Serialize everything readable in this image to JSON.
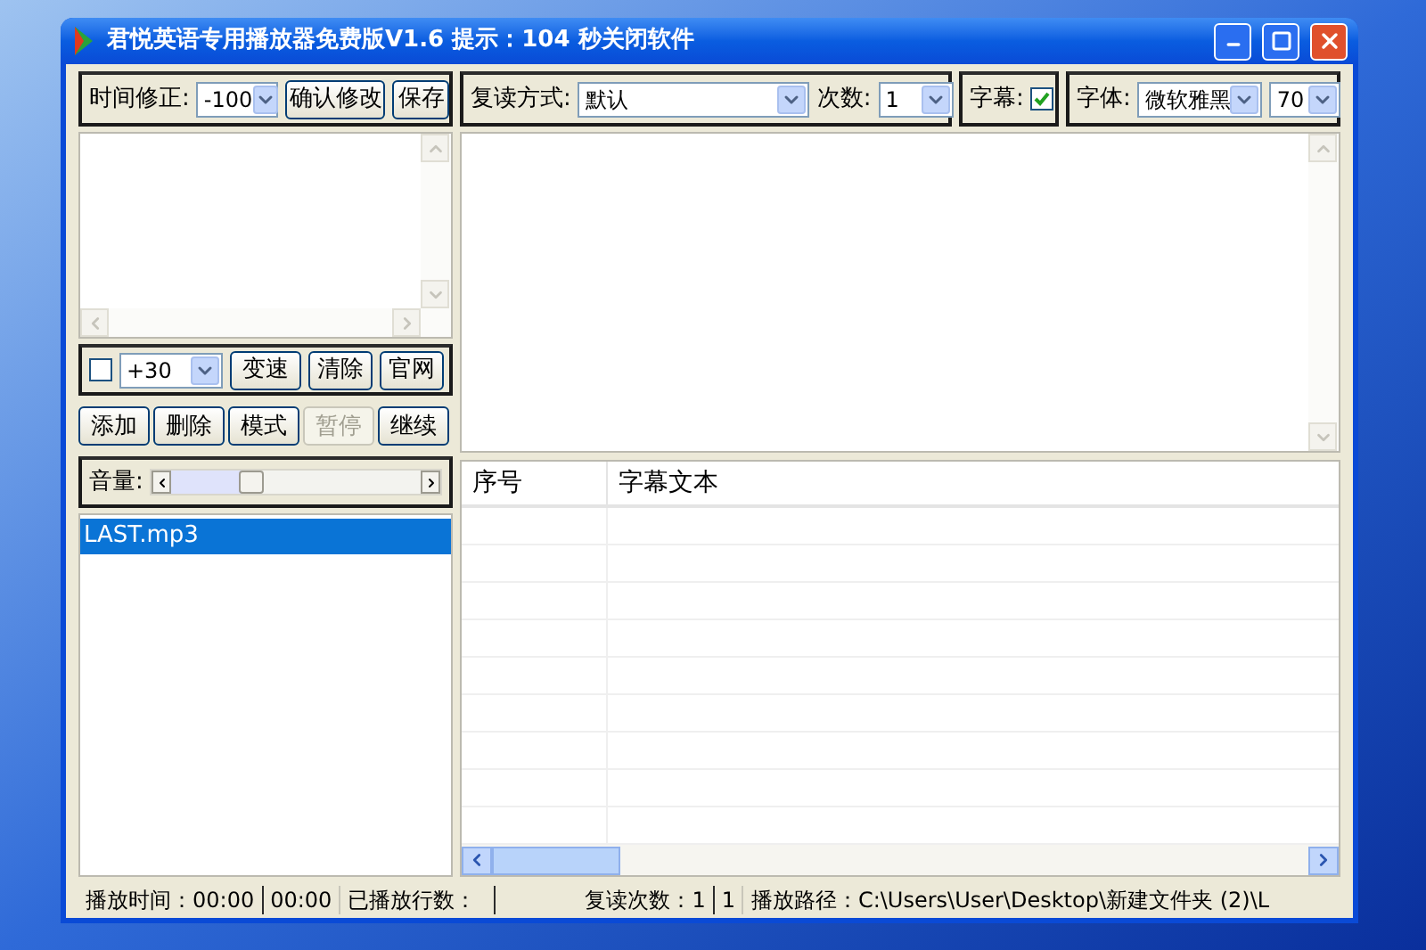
{
  "window": {
    "title": "君悦英语专用播放器免费版V1.6 提示：104 秒关闭软件"
  },
  "time_correction": {
    "label": "时间修正:",
    "value": "-100",
    "buttons": [
      "确认修改",
      "保存"
    ]
  },
  "repeat": {
    "label": "复读方式:",
    "value": "默认",
    "count_label": "次数:",
    "count_value": "1"
  },
  "subtitle": {
    "label": "字幕:",
    "checked": true
  },
  "font": {
    "label": "字体:",
    "value": "微软雅黑",
    "size": "70"
  },
  "speed": {
    "checked": false,
    "value": "+30",
    "buttons": [
      "变速",
      "清除",
      "官网"
    ]
  },
  "controls": [
    {
      "label": "添加",
      "disabled": false
    },
    {
      "label": "删除",
      "disabled": false
    },
    {
      "label": "模式",
      "disabled": false
    },
    {
      "label": "暂停",
      "disabled": true
    },
    {
      "label": "继续",
      "disabled": false
    }
  ],
  "volume": {
    "label": "音量:",
    "level": 0.32
  },
  "files": [
    {
      "name": "LAST.mp3",
      "selected": true
    }
  ],
  "subtitle_table": {
    "columns": [
      "序号",
      "字幕文本"
    ]
  },
  "status_bar": [
    {
      "text": "播放时间：00:00"
    },
    {
      "text": "00:00"
    },
    {
      "text": "已播放行数："
    },
    {
      "text": "复读次数：1"
    },
    {
      "text": "1"
    },
    {
      "text": "播放路径：C:\\Users\\User\\Desktop\\新建文件夹 (2)\\L"
    }
  ]
}
